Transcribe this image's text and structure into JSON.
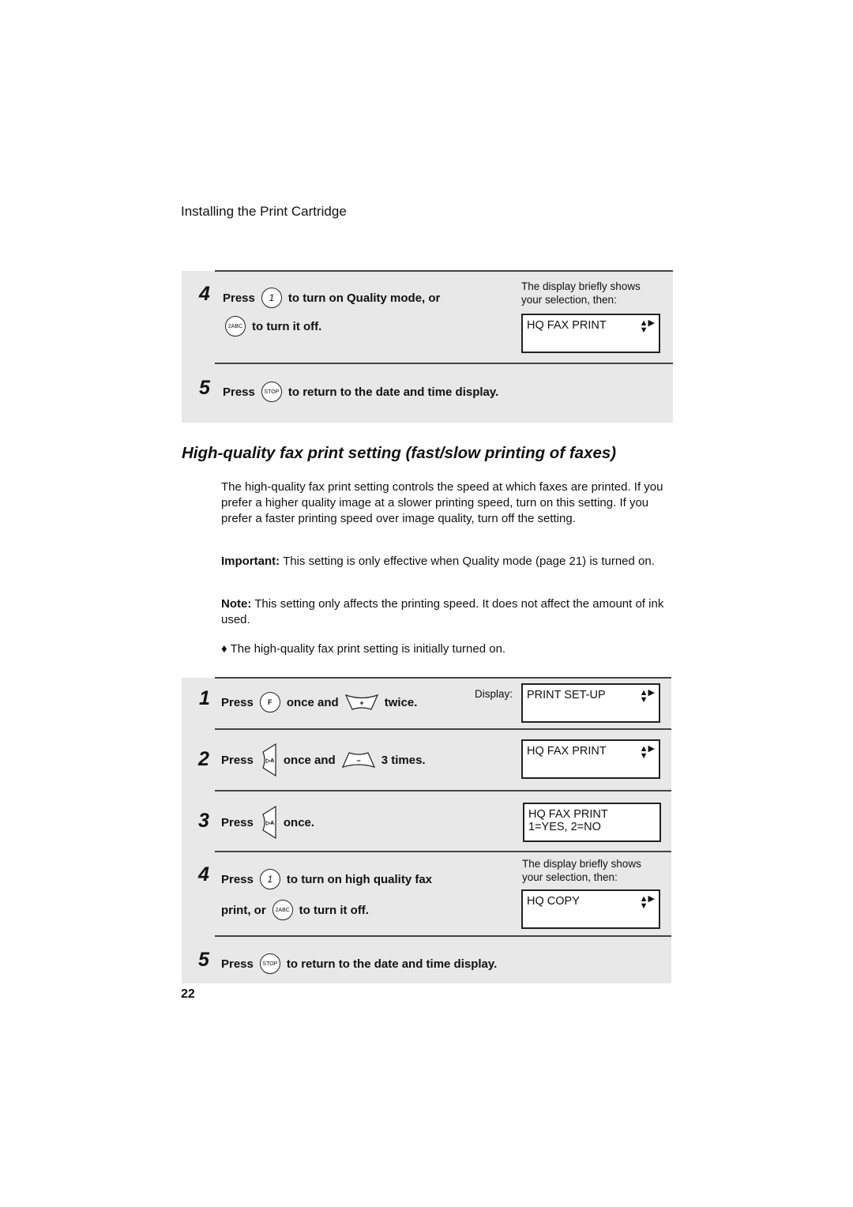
{
  "header": "Installing the Print Cartridge",
  "top_steps": {
    "step4": {
      "num": "4",
      "press": "Press",
      "key1": "1",
      "text1": "to turn on Quality mode, or",
      "key2": "2ABC",
      "text2": "to turn it off.",
      "note": "The display briefly shows your selection, then:",
      "display": "HQ FAX PRINT"
    },
    "step5": {
      "num": "5",
      "press": "Press",
      "key": "STOP",
      "text": "to return to the date and time display."
    }
  },
  "section_title": "High-quality fax print setting (fast/slow printing of faxes)",
  "paragraphs": {
    "intro": "The high-quality fax print setting controls the speed at which faxes are printed. If you prefer a higher quality image at a slower printing speed, turn on this setting. If you prefer a faster printing speed over image quality, turn off the setting.",
    "important_label": "Important:",
    "important": " This setting is only effective when Quality mode (page 21) is turned on.",
    "note_label": "Note:",
    "note": " This setting only affects the printing speed. It does not affect the amount of ink used.",
    "bullet": "The high-quality fax print setting is initially turned on."
  },
  "steps": {
    "s1": {
      "num": "1",
      "press": "Press",
      "key": "F",
      "mid": "once and",
      "end": "twice.",
      "display_label": "Display:",
      "display": "PRINT SET-UP"
    },
    "s2": {
      "num": "2",
      "press": "Press",
      "mid": "once and",
      "end": "3 times.",
      "display": "HQ FAX PRINT"
    },
    "s3": {
      "num": "3",
      "press": "Press",
      "end": "once.",
      "display1": "HQ FAX PRINT",
      "display2": "1=YES, 2=NO"
    },
    "s4": {
      "num": "4",
      "press": "Press",
      "key1": "1",
      "text1": "to turn on high quality fax",
      "pre2": "print, or",
      "key2": "2ABC",
      "text2": "to turn it off.",
      "note": "The display briefly shows your selection, then:",
      "display": "HQ COPY"
    },
    "s5": {
      "num": "5",
      "press": "Press",
      "key": "STOP",
      "text": "to return to the date and time display."
    }
  },
  "page_number": "22",
  "icons": {
    "updown": "up-down-right-arrow-icon",
    "nav": "arrow-key-icon"
  }
}
